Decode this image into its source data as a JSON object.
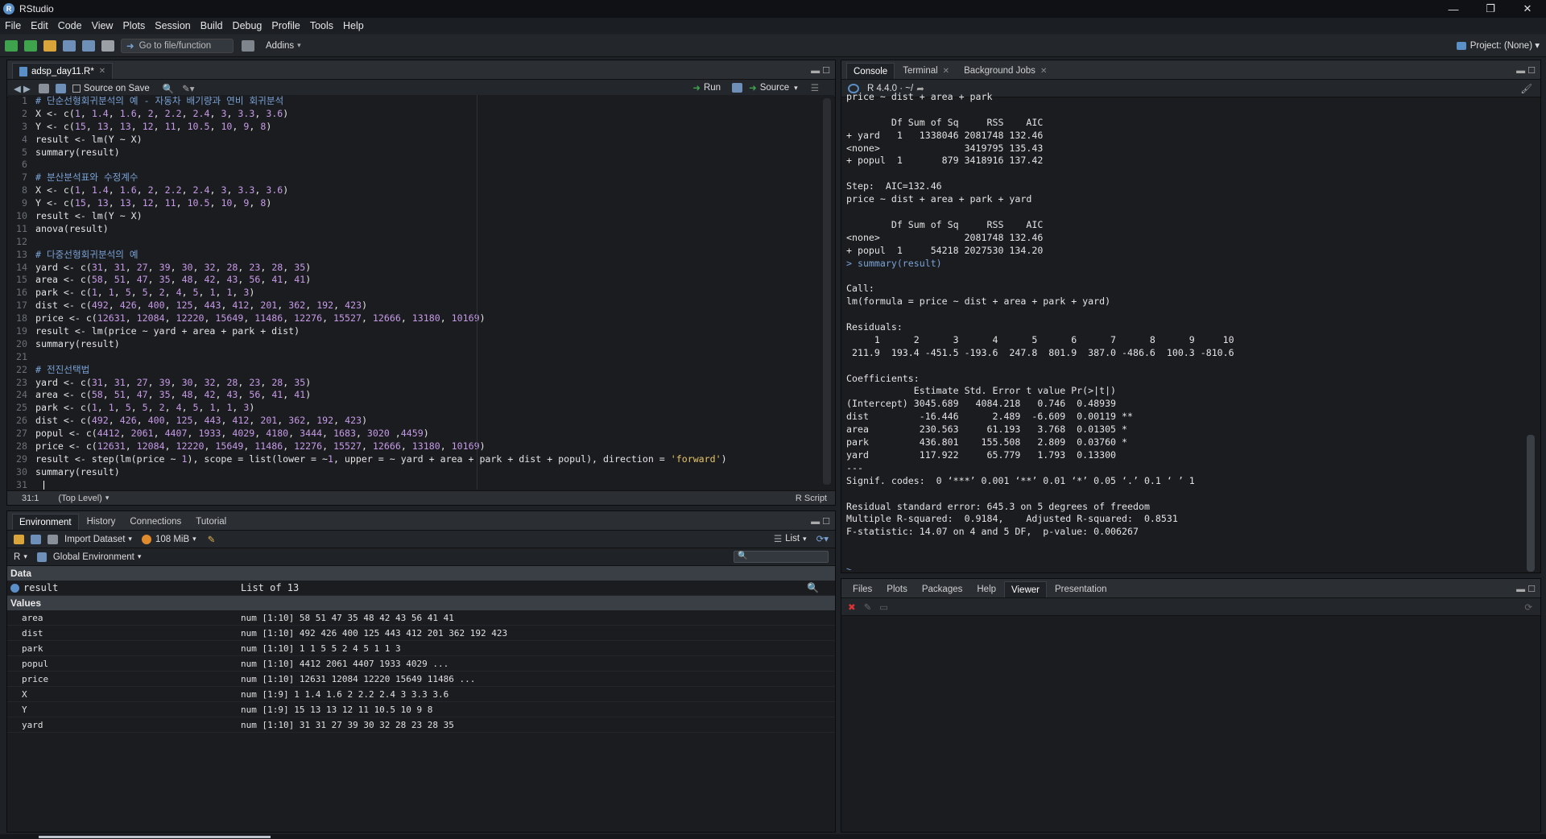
{
  "window": {
    "title": "RStudio",
    "controls": [
      "—",
      "❐",
      "✕"
    ]
  },
  "menu": [
    "File",
    "Edit",
    "Code",
    "View",
    "Plots",
    "Session",
    "Build",
    "Debug",
    "Profile",
    "Tools",
    "Help"
  ],
  "toolbar": {
    "goto_placeholder": "Go to file/function",
    "addins": "Addins",
    "project": "Project: (None)"
  },
  "source": {
    "tab": "adsp_day11.R*",
    "source_on_save": "Source on Save",
    "run": "Run",
    "source_btn": "Source",
    "cursor_pos": "31:1",
    "scope": "(Top Level)",
    "filetype": "R Script",
    "lines": [
      {
        "n": "1",
        "t": "# 단순선형회귀분석의 예 - 자동차 배기량과 연비 회귀분석",
        "k": "com"
      },
      {
        "n": "2",
        "t": "X <- c(1, 1.4, 1.6, 2, 2.2, 2.4, 3, 3.3, 3.6)",
        "k": "code"
      },
      {
        "n": "3",
        "t": "Y <- c(15, 13, 13, 12, 11, 10.5, 10, 9, 8)",
        "k": "code"
      },
      {
        "n": "4",
        "t": "result <- lm(Y ~ X)",
        "k": "code"
      },
      {
        "n": "5",
        "t": "summary(result)",
        "k": "code"
      },
      {
        "n": "6",
        "t": "",
        "k": "code"
      },
      {
        "n": "7",
        "t": "# 분산분석표와 수정계수",
        "k": "com"
      },
      {
        "n": "8",
        "t": "X <- c(1, 1.4, 1.6, 2, 2.2, 2.4, 3, 3.3, 3.6)",
        "k": "code"
      },
      {
        "n": "9",
        "t": "Y <- c(15, 13, 13, 12, 11, 10.5, 10, 9, 8)",
        "k": "code"
      },
      {
        "n": "10",
        "t": "result <- lm(Y ~ X)",
        "k": "code"
      },
      {
        "n": "11",
        "t": "anova(result)",
        "k": "code"
      },
      {
        "n": "12",
        "t": "",
        "k": "code"
      },
      {
        "n": "13",
        "t": "# 다중선형회귀분석의 예",
        "k": "com"
      },
      {
        "n": "14",
        "t": "yard <- c(31, 31, 27, 39, 30, 32, 28, 23, 28, 35)",
        "k": "code"
      },
      {
        "n": "15",
        "t": "area <- c(58, 51, 47, 35, 48, 42, 43, 56, 41, 41)",
        "k": "code"
      },
      {
        "n": "16",
        "t": "park <- c(1, 1, 5, 5, 2, 4, 5, 1, 1, 3)",
        "k": "code"
      },
      {
        "n": "17",
        "t": "dist <- c(492, 426, 400, 125, 443, 412, 201, 362, 192, 423)",
        "k": "code"
      },
      {
        "n": "18",
        "t": "price <- c(12631, 12084, 12220, 15649, 11486, 12276, 15527, 12666, 13180, 10169)",
        "k": "code"
      },
      {
        "n": "19",
        "t": "result <- lm(price ~ yard + area + park + dist)",
        "k": "code"
      },
      {
        "n": "20",
        "t": "summary(result)",
        "k": "code"
      },
      {
        "n": "21",
        "t": "",
        "k": "code"
      },
      {
        "n": "22",
        "t": "# 전진선택법",
        "k": "com"
      },
      {
        "n": "23",
        "t": "yard <- c(31, 31, 27, 39, 30, 32, 28, 23, 28, 35)",
        "k": "code"
      },
      {
        "n": "24",
        "t": "area <- c(58, 51, 47, 35, 48, 42, 43, 56, 41, 41)",
        "k": "code"
      },
      {
        "n": "25",
        "t": "park <- c(1, 1, 5, 5, 2, 4, 5, 1, 1, 3)",
        "k": "code"
      },
      {
        "n": "26",
        "t": "dist <- c(492, 426, 400, 125, 443, 412, 201, 362, 192, 423)",
        "k": "code"
      },
      {
        "n": "27",
        "t": "popul <- c(4412, 2061, 4407, 1933, 4029, 4180, 3444, 1683, 3020 ,4459)",
        "k": "code"
      },
      {
        "n": "28",
        "t": "price <- c(12631, 12084, 12220, 15649, 11486, 12276, 15527, 12666, 13180, 10169)",
        "k": "code"
      },
      {
        "n": "29",
        "t": "result <- step(lm(price ~ 1), scope = list(lower = ~1, upper = ~ yard + area + park + dist + popul), direction = 'forward')",
        "k": "code"
      },
      {
        "n": "30",
        "t": "summary(result)",
        "k": "code"
      },
      {
        "n": "31",
        "t": "",
        "k": "code"
      }
    ]
  },
  "console": {
    "tabs": [
      "Console",
      "Terminal",
      "Background Jobs"
    ],
    "r_version": "R 4.4.0 · ~/",
    "lines": [
      "price ~ dist + area + park",
      "",
      "        Df Sum of Sq     RSS    AIC",
      "+ yard   1   1338046 2081748 132.46",
      "<none>               3419795 135.43",
      "+ popul  1       879 3418916 137.42",
      "",
      "Step:  AIC=132.46",
      "price ~ dist + area + park + yard",
      "",
      "        Df Sum of Sq     RSS    AIC",
      "<none>               2081748 132.46",
      "+ popul  1     54218 2027530 134.20",
      "> summary(result)",
      "",
      "Call:",
      "lm(formula = price ~ dist + area + park + yard)",
      "",
      "Residuals:",
      "     1      2      3      4      5      6      7      8      9     10 ",
      " 211.9  193.4 -451.5 -193.6  247.8  801.9  387.0 -486.6  100.3 -810.6 ",
      "",
      "Coefficients:",
      "            Estimate Std. Error t value Pr(>|t|)   ",
      "(Intercept) 3045.689   4084.218   0.746  0.48939   ",
      "dist         -16.446      2.489  -6.609  0.00119 **",
      "area         230.563     61.193   3.768  0.01305 * ",
      "park         436.801    155.508   2.809  0.03760 * ",
      "yard         117.922     65.779   1.793  0.13300   ",
      "---",
      "Signif. codes:  0 ‘***’ 0.001 ‘**’ 0.01 ‘*’ 0.05 ‘.’ 0.1 ‘ ’ 1",
      "",
      "Residual standard error: 645.3 on 5 degrees of freedom",
      "Multiple R-squared:  0.9184,\tAdjusted R-squared:  0.8531 ",
      "F-statistic: 14.07 on 4 and 5 DF,  p-value: 0.006267",
      "",
      ""
    ],
    "prompt": "> "
  },
  "env": {
    "tabs": [
      "Environment",
      "History",
      "Connections",
      "Tutorial"
    ],
    "import": "Import Dataset",
    "memory": "108 MiB",
    "view": "List",
    "lang": "R",
    "scope": "Global Environment",
    "data_header": "Data",
    "data_rows": [
      {
        "name": "result",
        "value": "List of  13"
      }
    ],
    "values_header": "Values",
    "value_rows": [
      {
        "name": "area",
        "value": "num [1:10] 58 51 47 35 48 42 43 56 41 41"
      },
      {
        "name": "dist",
        "value": "num [1:10] 492 426 400 125 443 412 201 362 192 423"
      },
      {
        "name": "park",
        "value": "num [1:10] 1 1 5 5 2 4 5 1 1 3"
      },
      {
        "name": "popul",
        "value": "num [1:10] 4412 2061 4407 1933 4029 ..."
      },
      {
        "name": "price",
        "value": "num [1:10] 12631 12084 12220 15649 11486 ..."
      },
      {
        "name": "X",
        "value": "num [1:9] 1 1.4 1.6 2 2.2 2.4 3 3.3 3.6"
      },
      {
        "name": "Y",
        "value": "num [1:9] 15 13 13 12 11 10.5 10 9 8"
      },
      {
        "name": "yard",
        "value": "num [1:10] 31 31 27 39 30 32 28 23 28 35"
      }
    ]
  },
  "files": {
    "tabs": [
      "Files",
      "Plots",
      "Packages",
      "Help",
      "Viewer",
      "Presentation"
    ],
    "active": "Viewer"
  },
  "colors": {
    "accent": "#5b8fc7",
    "comment": "#7aa2d6",
    "number": "#c79ae8",
    "string": "#e9c46a"
  }
}
